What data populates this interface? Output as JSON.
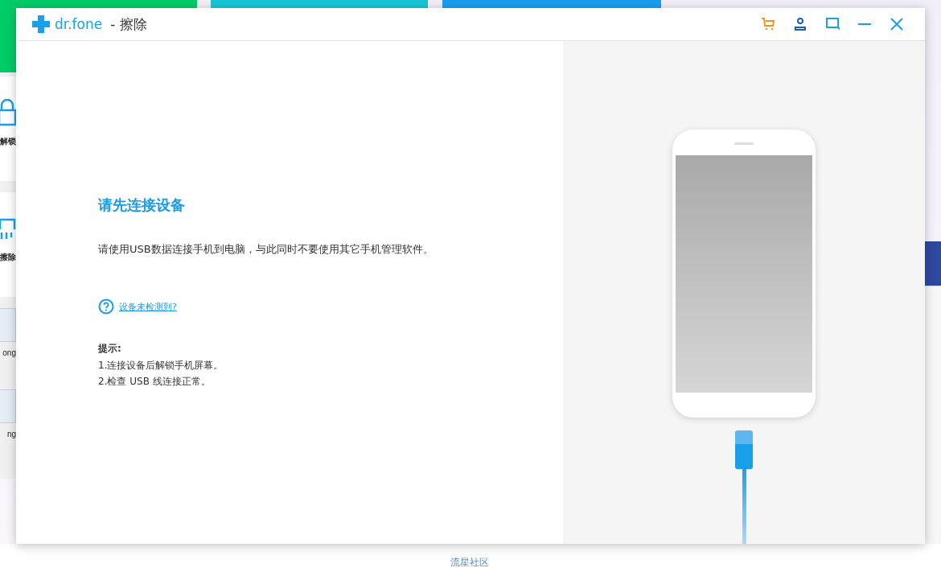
{
  "background": {
    "tiles": [
      {
        "color": "#00cc66"
      },
      {
        "color": "#17c6d6"
      },
      {
        "color": "#1aa0f0"
      }
    ],
    "tools": [
      {
        "kind": "lock",
        "label": "解锁"
      },
      {
        "kind": "erase",
        "label": "擦除"
      }
    ],
    "thumbnails": [
      {
        "label": "ong"
      },
      {
        "label": "ng"
      }
    ],
    "footer_link": "流星社区"
  },
  "window": {
    "brand": "dr.fone",
    "title": "- 擦除"
  },
  "main": {
    "heading": "请先连接设备",
    "description": "请使用USB数据连接手机到电脑，与此同时不要使用其它手机管理软件。",
    "help_link": "设备未检测到?",
    "tips_title": "提示:",
    "tips": [
      "1.连接设备后解锁手机屏幕。",
      "2.检查 USB 线连接正常。"
    ]
  }
}
